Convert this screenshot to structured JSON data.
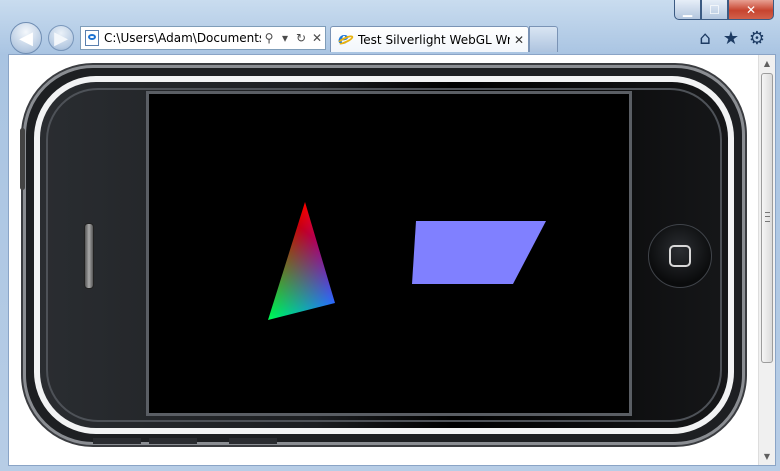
{
  "window_controls": {
    "minimize": "▁",
    "maximize": "☐",
    "close": "✕"
  },
  "navigation": {
    "back": "◀",
    "forward": "▶"
  },
  "address_bar": {
    "url": "C:\\Users\\Adam\\Documents\\",
    "search_glyph": "⚲",
    "dropdown_glyph": "▾",
    "refresh_glyph": "↻",
    "stop_glyph": "✕"
  },
  "tabs": [
    {
      "label": "Test Silverlight WebGL Wra...",
      "close_glyph": "✕"
    }
  ],
  "toolbar": {
    "home_glyph": "⌂",
    "favorites_glyph": "★",
    "tools_glyph": "⚙"
  },
  "scrollbar": {
    "up_glyph": "▲",
    "down_glyph": "▼"
  },
  "scene": {
    "triangle_colors": [
      "#ff0000",
      "#00ff00",
      "#0000ff"
    ],
    "parallelogram_color": "#8080ff",
    "background": "#000000"
  }
}
